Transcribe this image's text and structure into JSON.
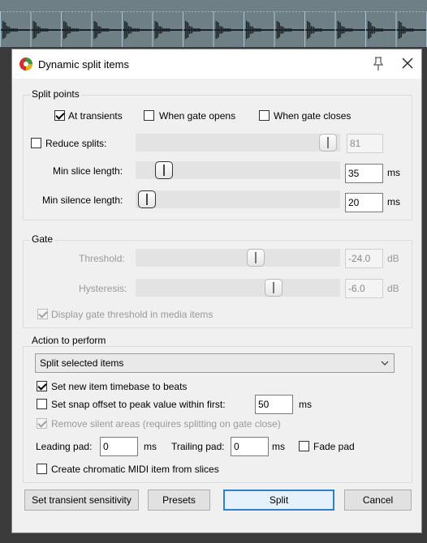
{
  "dialog": {
    "title": "Dynamic split items",
    "icons": {
      "app": "reaper-logo-icon",
      "pin": "pin-icon",
      "close": "close-icon"
    }
  },
  "split_points": {
    "label": "Split points",
    "at_transients": {
      "label": "At transients",
      "checked": true
    },
    "when_gate_opens": {
      "label": "When gate opens",
      "checked": false
    },
    "when_gate_closes": {
      "label": "When gate closes",
      "checked": false
    },
    "reduce_splits": {
      "label": "Reduce splits:",
      "checked": false,
      "value": "81"
    },
    "min_slice_length": {
      "label": "Min slice length:",
      "value": "35",
      "unit": "ms"
    },
    "min_silence_length": {
      "label": "Min silence length:",
      "value": "20",
      "unit": "ms"
    }
  },
  "gate": {
    "label": "Gate",
    "threshold": {
      "label": "Threshold:",
      "value": "-24.0",
      "unit": "dB"
    },
    "hysteresis": {
      "label": "Hysteresis:",
      "value": "-6.0",
      "unit": "dB"
    },
    "display_threshold": {
      "label": "Display gate threshold in media items",
      "checked": true
    }
  },
  "action": {
    "label": "Action to perform",
    "selected": "Split selected items",
    "set_timebase": {
      "label": "Set new item timebase to beats",
      "checked": true
    },
    "snap_offset": {
      "label": "Set snap offset to peak value within first:",
      "checked": false,
      "value": "50",
      "unit": "ms"
    },
    "remove_silent": {
      "label": "Remove silent areas (requires splitting on gate close)",
      "checked": true
    },
    "leading_pad": {
      "label": "Leading pad:",
      "value": "0",
      "unit": "ms"
    },
    "trailing_pad": {
      "label": "Trailing pad:",
      "value": "0",
      "unit": "ms"
    },
    "fade_pad": {
      "label": "Fade pad",
      "checked": false
    },
    "chromatic_midi": {
      "label": "Create chromatic MIDI item from slices",
      "checked": false
    }
  },
  "buttons": {
    "transient_sensitivity": "Set transient sensitivity",
    "presets": "Presets",
    "split": "Split",
    "cancel": "Cancel"
  },
  "colors": {
    "accent": "#2f7fd4",
    "waveform_bg": "#6f7f86",
    "waveform": "#1d2326"
  }
}
